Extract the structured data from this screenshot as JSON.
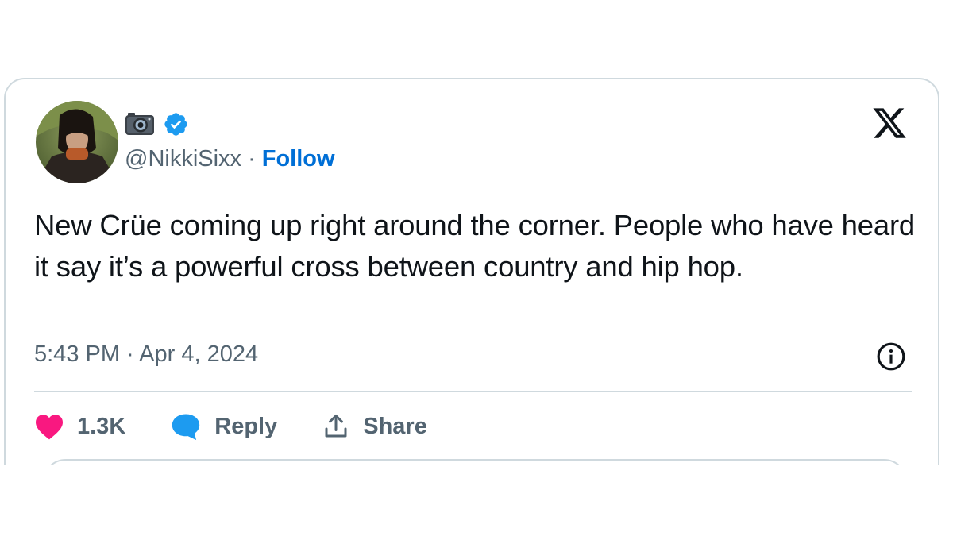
{
  "tweet": {
    "display_name_emoji": "camera-emoji",
    "verified": true,
    "handle": "@NikkiSixx",
    "separator": "·",
    "follow_label": "Follow",
    "text": "New Crüe coming up right around the corner. People who have heard it say it’s a powerful cross between country and hip hop.",
    "timestamp": "5:43 PM · Apr 4, 2024"
  },
  "actions": {
    "like_count": "1.3K",
    "reply_label": "Reply",
    "share_label": "Share"
  },
  "icons": {
    "brand": "x-logo-icon",
    "verified": "verified-badge-icon",
    "info": "info-icon",
    "like": "heart-icon",
    "reply": "speech-bubble-icon",
    "share": "share-upload-icon"
  },
  "colors": {
    "link": "#006fd6",
    "verified": "#1d9bf0",
    "like": "#f91880",
    "reply": "#1d9bf0",
    "text": "#0f1419",
    "muted": "#536471",
    "border": "#cfd9de"
  }
}
